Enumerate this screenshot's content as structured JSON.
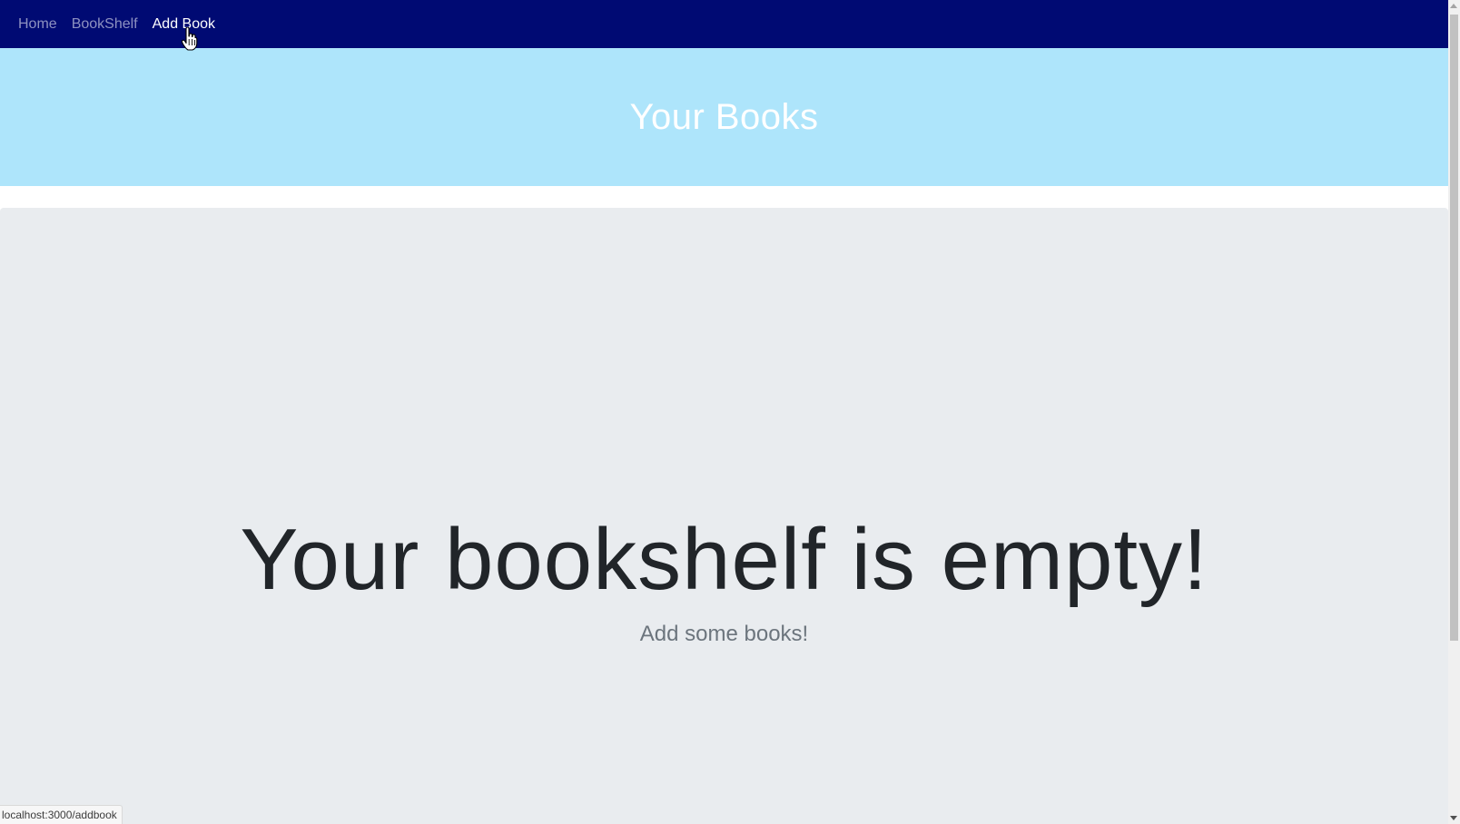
{
  "nav": {
    "items": [
      {
        "label": "Home",
        "active": false
      },
      {
        "label": "BookShelf",
        "active": false
      },
      {
        "label": "Add Book",
        "active": true
      }
    ],
    "background": "#000a73"
  },
  "banner": {
    "title": "Your Books",
    "background": "#aee5fb"
  },
  "jumbotron": {
    "heading": "Your bookshelf is empty!",
    "subtext": "Add some books!",
    "background": "#e9ecef"
  },
  "status": {
    "url": "localhost:3000/addbook"
  },
  "cursor": {
    "icon": "hand-pointer-icon"
  }
}
